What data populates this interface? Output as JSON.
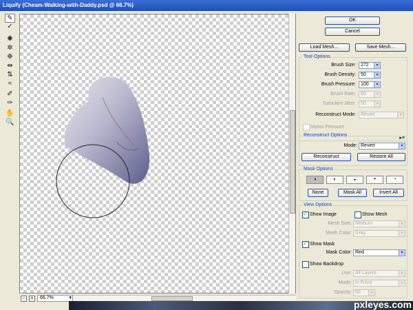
{
  "window": {
    "title": "Liquify (Cheam-Walking-with-Daddy.psd @ 66.7%)"
  },
  "tools": [
    {
      "name": "forward-warp-icon",
      "glyph": "✎"
    },
    {
      "name": "reconstruct-icon",
      "glyph": "✓"
    },
    {
      "name": "twirl-icon",
      "glyph": "✺"
    },
    {
      "name": "pucker-icon",
      "glyph": "✲"
    },
    {
      "name": "bloat-icon",
      "glyph": "❉"
    },
    {
      "name": "push-left-icon",
      "glyph": "⇹"
    },
    {
      "name": "mirror-icon",
      "glyph": "⇅"
    },
    {
      "name": "turbulence-icon",
      "glyph": "≈"
    },
    {
      "name": "freeze-mask-icon",
      "glyph": "✐"
    },
    {
      "name": "thaw-mask-icon",
      "glyph": "✑"
    },
    {
      "name": "hand-icon",
      "glyph": "✋"
    },
    {
      "name": "zoom-icon",
      "glyph": "🔍"
    }
  ],
  "zoom": {
    "minus": "-",
    "plus": "+",
    "value": "66.7%"
  },
  "buttons": {
    "ok": "OK",
    "cancel": "Cancel",
    "load_mesh": "Load Mesh...",
    "save_mesh": "Save Mesh..."
  },
  "tool_options": {
    "title": "Tool Options",
    "brush_size_label": "Brush Size:",
    "brush_size": "272",
    "brush_density_label": "Brush Density:",
    "brush_density": "50",
    "brush_pressure_label": "Brush Pressure:",
    "brush_pressure": "100",
    "brush_rate_label": "Brush Rate:",
    "brush_rate": "80",
    "turbulent_jitter_label": "Turbulent Jitter:",
    "turbulent_jitter": "50",
    "reconstruct_mode_label": "Reconstruct Mode:",
    "reconstruct_mode": "Revert",
    "stylus_pressure": "Stylus Pressure"
  },
  "reconstruct_options": {
    "title": "Reconstruct Options",
    "mode_label": "Mode:",
    "mode": "Revert",
    "reconstruct": "Reconstruct",
    "restore_all": "Restore All"
  },
  "mask_options": {
    "title": "Mask Options",
    "none": "None",
    "mask_all": "Mask All",
    "invert_all": "Invert All"
  },
  "view_options": {
    "title": "View Options",
    "show_image": "Show Image",
    "show_mesh": "Show Mesh",
    "mesh_size_label": "Mesh Size:",
    "mesh_size": "Medium",
    "mesh_color_label": "Mesh Color:",
    "mesh_color": "Gray",
    "show_mask": "Show Mask",
    "mask_color_label": "Mask Color:",
    "mask_color": "Red",
    "show_backdrop": "Show Backdrop",
    "use_label": "Use:",
    "use": "All Layers",
    "mode_label": "Mode:",
    "mode": "In Front",
    "opacity_label": "Opacity:",
    "opacity": "50"
  },
  "watermark": "pxleyes.com"
}
